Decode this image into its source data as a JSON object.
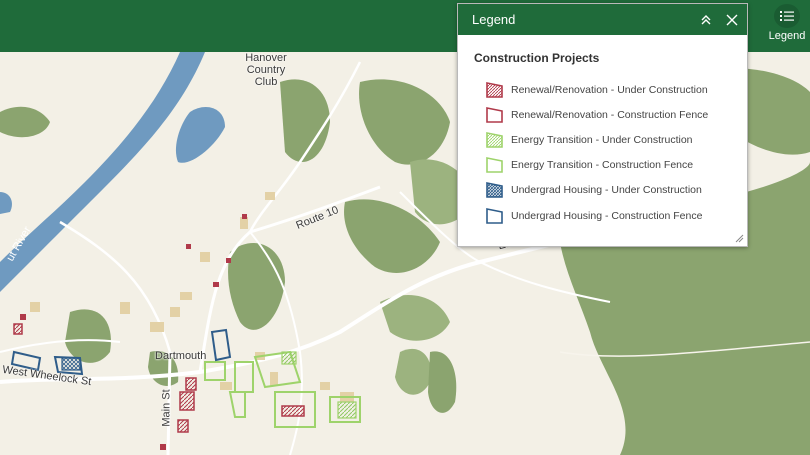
{
  "app": {
    "legend_button_label": "Legend"
  },
  "legend_panel": {
    "title": "Legend",
    "section_title": "Construction Projects",
    "items": [
      {
        "label": "Renewal/Renovation - Under Construction",
        "color": "#b03a4a",
        "style": "hatched"
      },
      {
        "label": "Renewal/Renovation - Construction Fence",
        "color": "#b03a4a",
        "style": "outline"
      },
      {
        "label": "Energy Transition - Under Construction",
        "color": "#9ed36b",
        "style": "hatched"
      },
      {
        "label": "Energy Transition - Construction Fence",
        "color": "#9ed36b",
        "style": "outline"
      },
      {
        "label": "Undergrad Housing - Under Construction",
        "color": "#2f5d8a",
        "style": "hatched"
      },
      {
        "label": "Undergrad Housing - Construction Fence",
        "color": "#2f5d8a",
        "style": "outline"
      }
    ]
  },
  "map": {
    "labels": {
      "country_club": "Hanover Country Club",
      "route_10": "Route 10",
      "dartmouth": "Dartmouth",
      "west_wheelock": "West Wheelock St",
      "main_st": "Main St",
      "river": "ut River",
      "east": "Eas"
    }
  },
  "colors": {
    "brand_green": "#1f6b3a",
    "water": "#6f9ac0",
    "forest": "#8ba46f",
    "land": "#f3f0e6"
  }
}
